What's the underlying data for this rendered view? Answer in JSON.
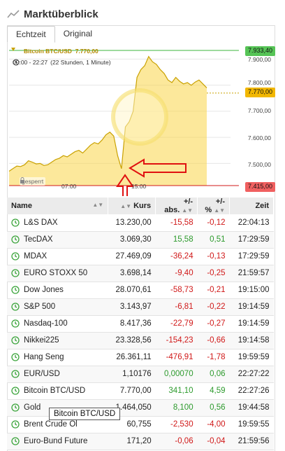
{
  "header": {
    "title": "Marktüberblick"
  },
  "tabs": [
    {
      "label": "Echtzeit",
      "active": true
    },
    {
      "label": "Original",
      "active": false
    }
  ],
  "chart": {
    "series_label": "Bitcoin BTC/USD",
    "series_value": "7.770,00",
    "time_range": "00:00 - 22:27",
    "time_range_detail": "(22 Stunden, 1 Minute)",
    "locked_label": "gesperrt",
    "badge_high": "7.933,40",
    "badge_current": "7.770,00",
    "badge_low": "7.415,00",
    "y_ticks": [
      "7.900,00",
      "7.800,00",
      "7.700,00",
      "7.600,00",
      "7.500,00"
    ],
    "x_ticks": [
      "07:00",
      "15:00"
    ],
    "colors": {
      "fill": "#f9d548",
      "line": "#c9a100",
      "high_line": "#3cb43c",
      "low_line": "#d01818",
      "arrow": "#e01010",
      "current_badge": "#f2b700",
      "high_badge": "#56c456",
      "low_badge": "#f06060"
    }
  },
  "chart_data": {
    "type": "area",
    "title": "Bitcoin BTC/USD",
    "ylim": [
      7415,
      7933.4
    ],
    "y_ticks": [
      7500,
      7600,
      7700,
      7800,
      7900
    ],
    "x_ticks": [
      "07:00",
      "15:00"
    ],
    "series": [
      {
        "name": "Bitcoin BTC/USD",
        "values": [
          7470,
          7480,
          7490,
          7488,
          7495,
          7510,
          7505,
          7498,
          7500,
          7492,
          7495,
          7505,
          7515,
          7520,
          7530,
          7525,
          7535,
          7545,
          7550,
          7540,
          7555,
          7570,
          7580,
          7575,
          7590,
          7610,
          7620,
          7605,
          7530,
          7480,
          7640,
          7660,
          7700,
          7830,
          7860,
          7875,
          7910,
          7890,
          7880,
          7860,
          7845,
          7820,
          7810,
          7830,
          7815,
          7805,
          7810,
          7800,
          7812,
          7820,
          7805,
          7790
        ]
      }
    ],
    "high": 7933.4,
    "current": 7770.0,
    "low": 7415.0
  },
  "table": {
    "headers": {
      "name": "Name",
      "kurs": "Kurs",
      "abs": "+/- abs.",
      "pct": "+/- %",
      "zeit": "Zeit"
    },
    "rows": [
      {
        "name": "L&S DAX",
        "kurs": "13.230,00",
        "abs": "-15,58",
        "pct": "-0,12",
        "zeit": "22:04:13",
        "dir": "neg"
      },
      {
        "name": "TecDAX",
        "kurs": "3.069,30",
        "abs": "15,58",
        "pct": "0,51",
        "zeit": "17:29:59",
        "dir": "pos"
      },
      {
        "name": "MDAX",
        "kurs": "27.469,09",
        "abs": "-36,24",
        "pct": "-0,13",
        "zeit": "17:29:59",
        "dir": "neg"
      },
      {
        "name": "EURO STOXX 50",
        "kurs": "3.698,14",
        "abs": "-9,40",
        "pct": "-0,25",
        "zeit": "21:59:57",
        "dir": "neg"
      },
      {
        "name": "Dow Jones",
        "kurs": "28.070,61",
        "abs": "-58,73",
        "pct": "-0,21",
        "zeit": "19:15:00",
        "dir": "neg"
      },
      {
        "name": "S&P 500",
        "kurs": "3.143,97",
        "abs": "-6,81",
        "pct": "-0,22",
        "zeit": "19:14:59",
        "dir": "neg"
      },
      {
        "name": "Nasdaq-100",
        "kurs": "8.417,36",
        "abs": "-22,79",
        "pct": "-0,27",
        "zeit": "19:14:59",
        "dir": "neg"
      },
      {
        "name": "Nikkei225",
        "kurs": "23.328,56",
        "abs": "-154,23",
        "pct": "-0,66",
        "zeit": "19:14:58",
        "dir": "neg"
      },
      {
        "name": "Hang Seng",
        "kurs": "26.361,11",
        "abs": "-476,91",
        "pct": "-1,78",
        "zeit": "19:59:59",
        "dir": "neg"
      },
      {
        "name": "EUR/USD",
        "kurs": "1,10176",
        "abs": "0,00070",
        "pct": "0,06",
        "zeit": "22:27:22",
        "dir": "pos"
      },
      {
        "name": "Bitcoin BTC/USD",
        "kurs": "7.770,00",
        "abs": "341,10",
        "pct": "4,59",
        "zeit": "22:27:26",
        "dir": "pos"
      },
      {
        "name": "Gold",
        "kurs": "1.464,050",
        "abs": "8,100",
        "pct": "0,56",
        "zeit": "19:44:58",
        "dir": "pos"
      },
      {
        "name": "Brent Crude Ol",
        "kurs": "60,755",
        "abs": "-2,530",
        "pct": "-4,00",
        "zeit": "19:59:55",
        "dir": "neg"
      },
      {
        "name": "Euro-Bund Future",
        "kurs": "171,20",
        "abs": "-0,06",
        "pct": "-0,04",
        "zeit": "21:59:56",
        "dir": "neg"
      }
    ]
  },
  "tooltip": {
    "text": "Bitcoin BTC/USD"
  }
}
